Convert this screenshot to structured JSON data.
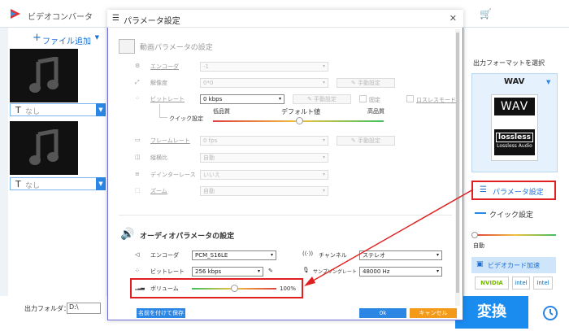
{
  "app": {
    "title": "ビデオコンバータ"
  },
  "left": {
    "add_label": "ファイル追加",
    "items": [
      {
        "subtitle": "なし"
      },
      {
        "subtitle": "なし"
      }
    ]
  },
  "right": {
    "format_label": "出力フォーマットを選択",
    "format_name": "WAV",
    "card_top": "WAV",
    "card_lossless": "lossless",
    "card_lossless_sub": "Lossless Audio",
    "param_button": "パラメータ設定",
    "quick_button": "クイック設定",
    "auto_label": "自動",
    "gpu_button": "ビデオカード加速",
    "vendors": [
      "NVIDIA",
      "intel",
      "Intel"
    ]
  },
  "bottom": {
    "folder_label": "出力フォルダ：",
    "folder_value": "D:\\",
    "convert": "変換"
  },
  "dialog": {
    "title": "パラメータ設定",
    "video": {
      "section": "動画パラメータの設定",
      "encoder_label": "エンコーダ",
      "encoder_value": "-1",
      "resolution_label": "解像度",
      "resolution_value": "0*0",
      "bitrate_label": "ビットレート",
      "bitrate_value": "0 kbps",
      "manual1": "手動設定",
      "manual2": "手動設定",
      "manual3": "手動設定",
      "cbr": "固定",
      "lossless": "ロスレスモード",
      "quick_label": "クイック設定",
      "low": "低品質",
      "default": "デフォルト値",
      "high": "高品質",
      "framerate_label": "フレームレート",
      "framerate_value": "0 fps",
      "aspect_label": "縦横比",
      "aspect_value": "自動",
      "deinterlace_label": "デインターレース",
      "deinterlace_value": "いいえ",
      "zoom_label": "ズーム",
      "zoom_value": "自動"
    },
    "audio": {
      "section": "オーディオパラメータの設定",
      "encoder_label": "エンコーダ",
      "encoder_value": "PCM_S16LE",
      "bitrate_label": "ビットレート",
      "bitrate_value": "256 kbps",
      "channel_label": "チャンネル",
      "channel_value": "ステレオ",
      "samplerate_label": "サンプリングレート",
      "samplerate_value": "48000 Hz",
      "volume_label": "ボリューム",
      "volume_value": "100%",
      "volume_level": 0.5
    },
    "buttons": {
      "save": "名前を付けて保存",
      "ok": "0k",
      "cancel": "キャンセル"
    }
  },
  "colors": {
    "accent": "#1a8cf0",
    "highlight": "#e02020",
    "cancel": "#f39a1a"
  }
}
